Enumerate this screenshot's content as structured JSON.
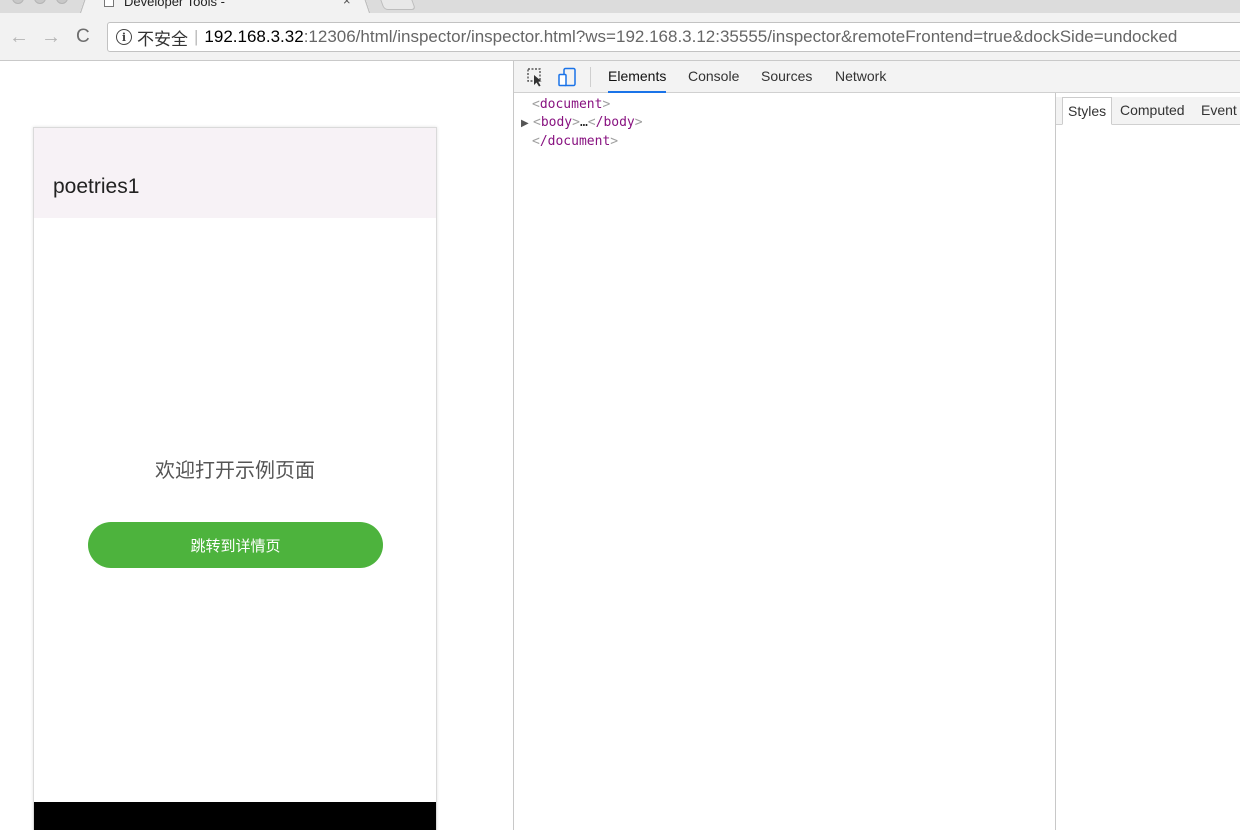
{
  "browser": {
    "tab_title": "Developer Tools -",
    "tab_close": "×",
    "nav": {
      "back": "←",
      "forward": "→",
      "reload": "C"
    },
    "security_label": "不安全",
    "separator": "|",
    "url_host": "192.168.3.32",
    "url_rest": ":12306/html/inspector/inspector.html?ws=192.168.3.12:35555/inspector&remoteFrontend=true&dockSide=undocked"
  },
  "app": {
    "title": "poetries1",
    "welcome": "欢迎打开示例页面",
    "button_label": "跳转到详情页",
    "accent_color": "#4db33d",
    "appbar_color": "#f7f2f6"
  },
  "devtools": {
    "tabs": [
      {
        "label": "Elements",
        "active": true
      },
      {
        "label": "Console",
        "active": false
      },
      {
        "label": "Sources",
        "active": false
      },
      {
        "label": "Network",
        "active": false
      }
    ],
    "dom": {
      "doc_open": "document",
      "body_open": "body",
      "ellipsis": "…",
      "body_close": "/body",
      "doc_close": "/document"
    },
    "side_tabs": [
      {
        "label": "Styles",
        "active": true
      },
      {
        "label": "Computed",
        "active": false
      },
      {
        "label": "Event",
        "active": false
      }
    ],
    "tag_color": "#881280"
  }
}
